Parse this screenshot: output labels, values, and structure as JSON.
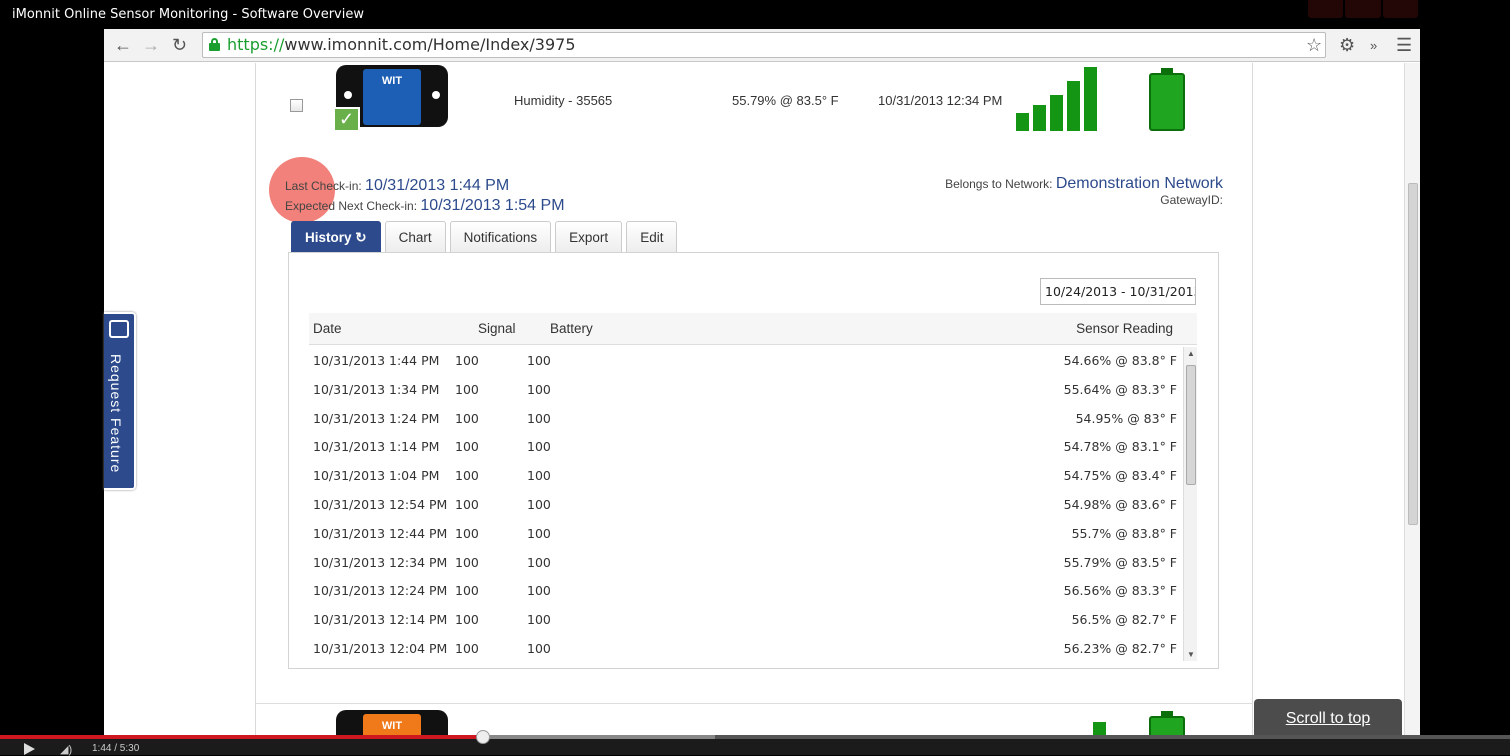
{
  "video": {
    "title": "iMonnit Online Sensor Monitoring - Software Overview",
    "time": "1:44 / 5:30",
    "progress_fraction": 0.32
  },
  "browser": {
    "url_scheme": "https://",
    "url_rest": "www.imonnit.com/Home/Index/3975"
  },
  "sensor": {
    "name": "Humidity - 35565",
    "reading": "55.79% @ 83.5° F",
    "date": "10/31/2013 12:34 PM",
    "device_brand": "WIT"
  },
  "checkin": {
    "last_label": "Last Check-in:",
    "last_value": "10/31/2013 1:44 PM",
    "next_label": "Expected Next Check-in:",
    "next_value": "10/31/2013 1:54 PM"
  },
  "network": {
    "label": "Belongs to Network:",
    "value": "Demonstration Network",
    "gateway_label": "GatewayID:"
  },
  "tabs": [
    {
      "label": "History"
    },
    {
      "label": "Chart"
    },
    {
      "label": "Notifications"
    },
    {
      "label": "Export"
    },
    {
      "label": "Edit"
    }
  ],
  "history": {
    "date_range": "10/24/2013 - 10/31/2013",
    "columns": {
      "date": "Date",
      "signal": "Signal",
      "battery": "Battery",
      "reading": "Sensor Reading"
    },
    "rows": [
      {
        "date": "10/31/2013 1:44 PM",
        "signal": "100",
        "battery": "100",
        "reading": "54.66% @ 83.8° F"
      },
      {
        "date": "10/31/2013 1:34 PM",
        "signal": "100",
        "battery": "100",
        "reading": "55.64% @ 83.3° F"
      },
      {
        "date": "10/31/2013 1:24 PM",
        "signal": "100",
        "battery": "100",
        "reading": "54.95% @ 83° F"
      },
      {
        "date": "10/31/2013 1:14 PM",
        "signal": "100",
        "battery": "100",
        "reading": "54.78% @ 83.1° F"
      },
      {
        "date": "10/31/2013 1:04 PM",
        "signal": "100",
        "battery": "100",
        "reading": "54.75% @ 83.4° F"
      },
      {
        "date": "10/31/2013 12:54 PM",
        "signal": "100",
        "battery": "100",
        "reading": "54.98% @ 83.6° F"
      },
      {
        "date": "10/31/2013 12:44 PM",
        "signal": "100",
        "battery": "100",
        "reading": "55.7% @ 83.8° F"
      },
      {
        "date": "10/31/2013 12:34 PM",
        "signal": "100",
        "battery": "100",
        "reading": "55.79% @ 83.5° F"
      },
      {
        "date": "10/31/2013 12:24 PM",
        "signal": "100",
        "battery": "100",
        "reading": "56.56% @ 83.3° F"
      },
      {
        "date": "10/31/2013 12:14 PM",
        "signal": "100",
        "battery": "100",
        "reading": "56.5% @ 82.7° F"
      },
      {
        "date": "10/31/2013 12:04 PM",
        "signal": "100",
        "battery": "100",
        "reading": "56.23% @ 82.7° F"
      }
    ]
  },
  "feature_tab": {
    "label": "Request Feature"
  },
  "scroll_to_top": {
    "label": "Scroll to top"
  },
  "colors": {
    "accent": "#2d4b8c",
    "signal_green": "#149614",
    "progress_red": "#cc181e"
  }
}
